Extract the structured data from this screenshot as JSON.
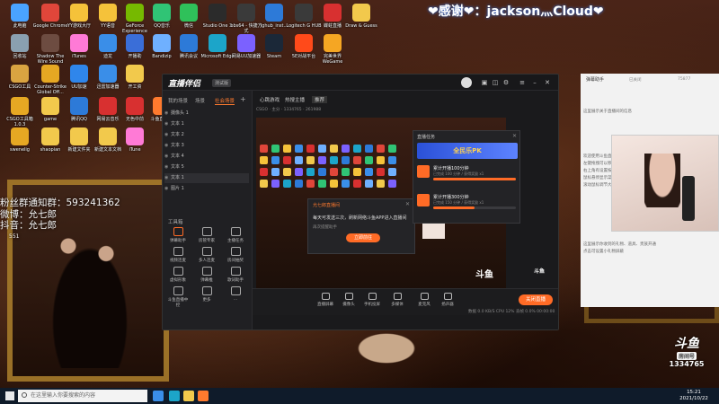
{
  "desktop": {
    "icons": [
      {
        "label": "此电脑",
        "color": "#4aa3ff"
      },
      {
        "label": "Google Chrome",
        "color": "#e0463a"
      },
      {
        "label": "YY游戏大厅",
        "color": "#f5c23a"
      },
      {
        "label": "YY语音",
        "color": "#f5c23a"
      },
      {
        "label": "GeForce Experience",
        "color": "#76b900"
      },
      {
        "label": "QQ音乐",
        "color": "#30c475"
      },
      {
        "label": "微信",
        "color": "#2fc15a"
      },
      {
        "label": "Studio One 3",
        "color": "#2b2b2b"
      },
      {
        "label": "obs64 - 快捷方式",
        "color": "#3a3a3a"
      },
      {
        "label": "lghub_inst...",
        "color": "#2d7ad8"
      },
      {
        "label": "Logitech G HUB",
        "color": "#3a3a3a"
      },
      {
        "label": "蝶蛀直播",
        "color": "#d83030"
      },
      {
        "label": "Draw & Guess",
        "color": "#f2c94c"
      },
      {
        "label": "回收站",
        "color": "#8aa0b0"
      },
      {
        "label": "Shadow The Wire Sound",
        "color": "#6d4c41"
      },
      {
        "label": "iTunes",
        "color": "#ff7ad6"
      },
      {
        "label": "迪龙",
        "color": "#3a8ee8"
      },
      {
        "label": "开播助",
        "color": "#3a6ed8"
      },
      {
        "label": "Bandizip",
        "color": "#6fb0ff"
      },
      {
        "label": "腾讯会议",
        "color": "#2d7ad8"
      },
      {
        "label": "Microsoft Edge",
        "color": "#1ca5c9"
      },
      {
        "label": "网易UU加速器",
        "color": "#7b61ff"
      },
      {
        "label": "Steam",
        "color": "#1b2838"
      },
      {
        "label": "5E对战平台",
        "color": "#ff4a1a"
      },
      {
        "label": "完美世界 WeGame",
        "color": "#f5a623"
      },
      {
        "label": "CSGO工具",
        "color": "#d9a441"
      },
      {
        "label": "Counter-Strike Global Off...",
        "color": "#e6a823"
      },
      {
        "label": "UU加速",
        "color": "#2f86eb"
      },
      {
        "label": "迅雷加速器",
        "color": "#3a8ee8"
      },
      {
        "label": "开工资",
        "color": "#f2c94c"
      },
      {
        "label": "CSGO工具箱 1.0.3",
        "color": "#e6a823"
      },
      {
        "label": "game",
        "color": "#f2c94c"
      },
      {
        "label": "腾讯QQ",
        "color": "#2d7ad8"
      },
      {
        "label": "网易云音乐",
        "color": "#d83030"
      },
      {
        "label": "无色中前",
        "color": "#d83030"
      },
      {
        "label": "斗鱼直播伴",
        "color": "#ff7a2e"
      },
      {
        "label": "swenelig",
        "color": "#e6a823"
      },
      {
        "label": "shaopian",
        "color": "#f2c94c"
      },
      {
        "label": "新建文件夹",
        "color": "#f2c94c"
      },
      {
        "label": "新建文本文档",
        "color": "#f2c94c"
      },
      {
        "label": "iTune",
        "color": "#ff7ad6"
      }
    ]
  },
  "overlay": {
    "thanks": "❤感谢❤：jackson灬Cloud❤",
    "fan_group": "粉丝群通知群：593241362",
    "weibo": "微博：允七郎",
    "douyin": "抖音：允七郎",
    "side_num": "551"
  },
  "app": {
    "logo": "直播伴侣",
    "version": "测试版",
    "left_tabs": [
      "我的场景",
      "场景",
      "社会场景"
    ],
    "scenes": [
      {
        "name": "摄像头 1",
        "sel": false
      },
      {
        "name": "文本 1",
        "sel": false
      },
      {
        "name": "文本 2",
        "sel": false
      },
      {
        "name": "文本 3",
        "sel": false
      },
      {
        "name": "文本 4",
        "sel": false
      },
      {
        "name": "文本 5",
        "sel": false
      },
      {
        "name": "文本 1",
        "sel": true
      },
      {
        "name": "图片 1",
        "sel": false
      }
    ],
    "tools_label": "工具箱",
    "tools": [
      {
        "label": "弹幕助手"
      },
      {
        "label": "房管专家"
      },
      {
        "label": "主播任务"
      },
      {
        "label": "视频连麦"
      },
      {
        "label": "多人连麦"
      },
      {
        "label": "房间抽奖"
      },
      {
        "label": "虚拟形象"
      },
      {
        "label": "弹幕推"
      },
      {
        "label": "歌词助手"
      },
      {
        "label": "斗鱼直播中控"
      },
      {
        "label": "更多"
      },
      {
        "label": "..."
      }
    ],
    "main_tabs": [
      "心跳游戏",
      "热搜主播",
      "推荐"
    ],
    "stats": "CSGO · 主分 · 1334765 · 261988",
    "modal": {
      "title": "允七郎直播间",
      "body": "每天可发送三次，刷新网络斗鱼APP进入直播间",
      "sub": "再次提醒助手",
      "button": "立即前往"
    },
    "task_panel": {
      "title": "直播任务",
      "banner": "全民乐PK",
      "tasks": [
        {
          "name": "累计开播100分钟",
          "sub": "已完成 100 分钟 / 获得奖励 x1",
          "progress": 1.0
        },
        {
          "name": "累计开播300分钟",
          "sub": "已完成 150 分钟 / 获得奖励 x1",
          "progress": 0.5
        }
      ]
    },
    "bottom": [
      {
        "label": "直播屏幕"
      },
      {
        "label": "摄像头"
      },
      {
        "label": "手机投屏"
      },
      {
        "label": "多媒体"
      },
      {
        "label": "麦克风"
      },
      {
        "label": "扬声器"
      }
    ],
    "live_button": "关闭直播",
    "status": "数据 0.0 KB/S  CPU 12%  丢帧 0.0%  00:00:00"
  },
  "right_panel": {
    "title": "弹幕助手",
    "a": "已关闭",
    "b": "75877",
    "chat": [
      "这里展示关于直播间的信息",
      "欢迎使用斗鱼直播伴侣",
      "左键拖拽可以移动位置",
      "右上角有设置按钮",
      "鼠标悬停显示菜单",
      "滚动鼠标调节大小",
      "这里展示你收到的礼物、道具、贵族开通",
      "点击可设置小礼物屏蔽"
    ]
  },
  "room": {
    "logo": "斗鱼",
    "label": "房间号",
    "number": "1334765"
  },
  "taskbar": {
    "search_placeholder": "在这里输入你要搜索的内容",
    "time": "15:21",
    "date": "2021/10/22"
  }
}
